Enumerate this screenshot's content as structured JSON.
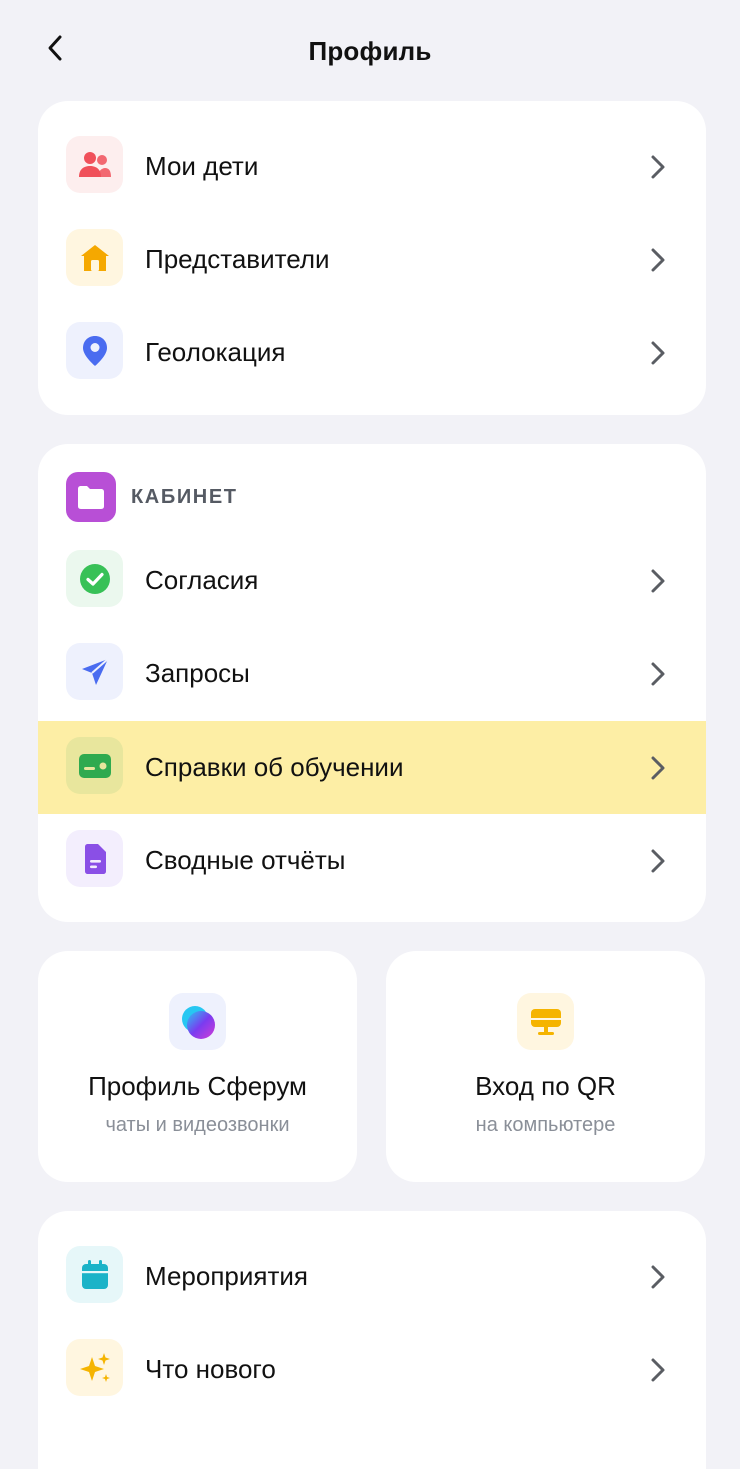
{
  "header": {
    "title": "Профиль"
  },
  "profile_menu": {
    "items": [
      {
        "label": "Мои дети",
        "icon": "children-icon"
      },
      {
        "label": "Представители",
        "icon": "home-icon"
      },
      {
        "label": "Геолокация",
        "icon": "location-pin-icon"
      }
    ]
  },
  "cabinet": {
    "title": "КАБИНЕТ",
    "icon": "folder-icon",
    "items": [
      {
        "label": "Согласия",
        "icon": "check-circle-icon"
      },
      {
        "label": "Запросы",
        "icon": "send-icon"
      },
      {
        "label": "Справки об обучении",
        "icon": "certificate-card-icon",
        "highlighted": true
      },
      {
        "label": "Сводные отчёты",
        "icon": "document-icon"
      }
    ]
  },
  "tiles": [
    {
      "title": "Профиль Сферум",
      "subtitle": "чаты и видеозвонки",
      "icon": "sferum-logo-icon"
    },
    {
      "title": "Вход по QR",
      "subtitle": "на компьютере",
      "icon": "monitor-icon"
    }
  ],
  "extra_menu": {
    "items": [
      {
        "label": "Мероприятия",
        "icon": "calendar-icon"
      },
      {
        "label": "Что нового",
        "icon": "sparkles-icon"
      }
    ]
  },
  "colors": {
    "background": "#f2f2f7",
    "highlight": "#fdeea5",
    "cabinet_accent": "#b84fd6",
    "children": "#f0505a",
    "home": "#f5a800",
    "location": "#4a6cf0",
    "check": "#38c157",
    "send": "#4a6cf0",
    "certificate": "#2faa4f",
    "document": "#8a4fe6",
    "calendar": "#1bb3c8",
    "sparkles": "#f5b400"
  }
}
